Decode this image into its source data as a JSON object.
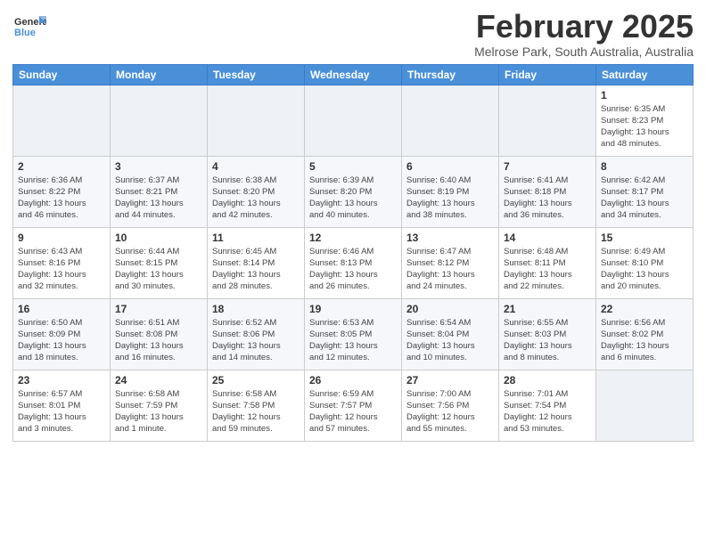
{
  "header": {
    "logo_line1": "General",
    "logo_line2": "Blue",
    "title": "February 2025",
    "subtitle": "Melrose Park, South Australia, Australia"
  },
  "calendar": {
    "days_of_week": [
      "Sunday",
      "Monday",
      "Tuesday",
      "Wednesday",
      "Thursday",
      "Friday",
      "Saturday"
    ],
    "weeks": [
      [
        {
          "day": "",
          "detail": ""
        },
        {
          "day": "",
          "detail": ""
        },
        {
          "day": "",
          "detail": ""
        },
        {
          "day": "",
          "detail": ""
        },
        {
          "day": "",
          "detail": ""
        },
        {
          "day": "",
          "detail": ""
        },
        {
          "day": "1",
          "detail": "Sunrise: 6:35 AM\nSunset: 8:23 PM\nDaylight: 13 hours\nand 48 minutes."
        }
      ],
      [
        {
          "day": "2",
          "detail": "Sunrise: 6:36 AM\nSunset: 8:22 PM\nDaylight: 13 hours\nand 46 minutes."
        },
        {
          "day": "3",
          "detail": "Sunrise: 6:37 AM\nSunset: 8:21 PM\nDaylight: 13 hours\nand 44 minutes."
        },
        {
          "day": "4",
          "detail": "Sunrise: 6:38 AM\nSunset: 8:20 PM\nDaylight: 13 hours\nand 42 minutes."
        },
        {
          "day": "5",
          "detail": "Sunrise: 6:39 AM\nSunset: 8:20 PM\nDaylight: 13 hours\nand 40 minutes."
        },
        {
          "day": "6",
          "detail": "Sunrise: 6:40 AM\nSunset: 8:19 PM\nDaylight: 13 hours\nand 38 minutes."
        },
        {
          "day": "7",
          "detail": "Sunrise: 6:41 AM\nSunset: 8:18 PM\nDaylight: 13 hours\nand 36 minutes."
        },
        {
          "day": "8",
          "detail": "Sunrise: 6:42 AM\nSunset: 8:17 PM\nDaylight: 13 hours\nand 34 minutes."
        }
      ],
      [
        {
          "day": "9",
          "detail": "Sunrise: 6:43 AM\nSunset: 8:16 PM\nDaylight: 13 hours\nand 32 minutes."
        },
        {
          "day": "10",
          "detail": "Sunrise: 6:44 AM\nSunset: 8:15 PM\nDaylight: 13 hours\nand 30 minutes."
        },
        {
          "day": "11",
          "detail": "Sunrise: 6:45 AM\nSunset: 8:14 PM\nDaylight: 13 hours\nand 28 minutes."
        },
        {
          "day": "12",
          "detail": "Sunrise: 6:46 AM\nSunset: 8:13 PM\nDaylight: 13 hours\nand 26 minutes."
        },
        {
          "day": "13",
          "detail": "Sunrise: 6:47 AM\nSunset: 8:12 PM\nDaylight: 13 hours\nand 24 minutes."
        },
        {
          "day": "14",
          "detail": "Sunrise: 6:48 AM\nSunset: 8:11 PM\nDaylight: 13 hours\nand 22 minutes."
        },
        {
          "day": "15",
          "detail": "Sunrise: 6:49 AM\nSunset: 8:10 PM\nDaylight: 13 hours\nand 20 minutes."
        }
      ],
      [
        {
          "day": "16",
          "detail": "Sunrise: 6:50 AM\nSunset: 8:09 PM\nDaylight: 13 hours\nand 18 minutes."
        },
        {
          "day": "17",
          "detail": "Sunrise: 6:51 AM\nSunset: 8:08 PM\nDaylight: 13 hours\nand 16 minutes."
        },
        {
          "day": "18",
          "detail": "Sunrise: 6:52 AM\nSunset: 8:06 PM\nDaylight: 13 hours\nand 14 minutes."
        },
        {
          "day": "19",
          "detail": "Sunrise: 6:53 AM\nSunset: 8:05 PM\nDaylight: 13 hours\nand 12 minutes."
        },
        {
          "day": "20",
          "detail": "Sunrise: 6:54 AM\nSunset: 8:04 PM\nDaylight: 13 hours\nand 10 minutes."
        },
        {
          "day": "21",
          "detail": "Sunrise: 6:55 AM\nSunset: 8:03 PM\nDaylight: 13 hours\nand 8 minutes."
        },
        {
          "day": "22",
          "detail": "Sunrise: 6:56 AM\nSunset: 8:02 PM\nDaylight: 13 hours\nand 6 minutes."
        }
      ],
      [
        {
          "day": "23",
          "detail": "Sunrise: 6:57 AM\nSunset: 8:01 PM\nDaylight: 13 hours\nand 3 minutes."
        },
        {
          "day": "24",
          "detail": "Sunrise: 6:58 AM\nSunset: 7:59 PM\nDaylight: 13 hours\nand 1 minute."
        },
        {
          "day": "25",
          "detail": "Sunrise: 6:58 AM\nSunset: 7:58 PM\nDaylight: 12 hours\nand 59 minutes."
        },
        {
          "day": "26",
          "detail": "Sunrise: 6:59 AM\nSunset: 7:57 PM\nDaylight: 12 hours\nand 57 minutes."
        },
        {
          "day": "27",
          "detail": "Sunrise: 7:00 AM\nSunset: 7:56 PM\nDaylight: 12 hours\nand 55 minutes."
        },
        {
          "day": "28",
          "detail": "Sunrise: 7:01 AM\nSunset: 7:54 PM\nDaylight: 12 hours\nand 53 minutes."
        },
        {
          "day": "",
          "detail": ""
        }
      ]
    ]
  }
}
